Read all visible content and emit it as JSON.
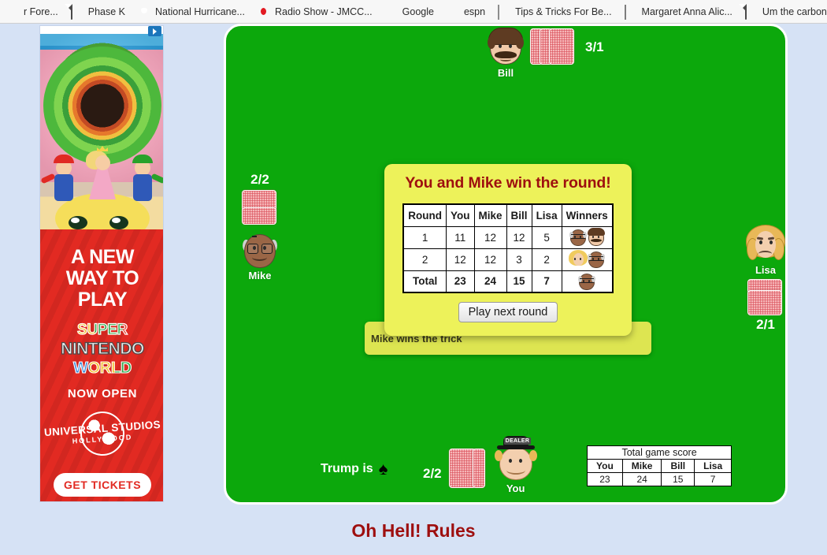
{
  "browser": {
    "bookmarks": [
      {
        "label": "r Fore...",
        "icon": "none"
      },
      {
        "label": "Phase K",
        "icon": "document-icon"
      },
      {
        "label": "National Hurricane...",
        "icon": "noaa-shield-icon"
      },
      {
        "label": "Radio Show - JMCC...",
        "icon": "radio-target-icon"
      },
      {
        "label": "Google",
        "icon": "google-g-icon"
      },
      {
        "label": "espn",
        "icon": "espn-icon"
      },
      {
        "label": "Tips & Tricks For Be...",
        "icon": "photo-thumbnail-icon"
      },
      {
        "label": "Margaret Anna Alic...",
        "icon": "photo-thumbnail-icon"
      },
      {
        "label": "Um the carbon tax i...",
        "icon": "document-icon"
      },
      {
        "label": "",
        "icon": "orange-bars-icon"
      }
    ]
  },
  "ad": {
    "headline_line1": "A NEW",
    "headline_line2": "WAY TO",
    "headline_line3": "PLAY",
    "brand_line1": "SUPER",
    "brand_line2": "NINTENDO",
    "brand_line3": "WORLD",
    "status": "NOW OPEN",
    "studio": "UNIVERSAL STUDIOS",
    "studio_sub": "HOLLYWOOD",
    "cta": "GET TICKETS"
  },
  "game": {
    "trump_label": "Trump is",
    "trump_suit": "♠",
    "players": {
      "bill": {
        "name": "Bill",
        "bid_tricks": "3/1",
        "cards": 3
      },
      "mike": {
        "name": "Mike",
        "bid_tricks": "2/2",
        "cards": 2
      },
      "lisa": {
        "name": "Lisa",
        "bid_tricks": "2/1",
        "cards": 2
      },
      "you": {
        "name": "You",
        "bid_tricks": "2/2",
        "cards": 2,
        "dealer_badge": "DEALER"
      }
    },
    "trick_message": "Mike wins the trick",
    "dialog": {
      "title": "You and Mike win the round!",
      "button": "Play next round",
      "table": {
        "headers": [
          "Round",
          "You",
          "Mike",
          "Bill",
          "Lisa",
          "Winners"
        ],
        "rows": [
          {
            "round": "1",
            "you": "11",
            "mike": "12",
            "bill": "12",
            "lisa": "5",
            "winners": [
              "mike",
              "bill"
            ]
          },
          {
            "round": "2",
            "you": "12",
            "mike": "12",
            "bill": "3",
            "lisa": "2",
            "winners": [
              "lisa",
              "mike"
            ]
          },
          {
            "round": "Total",
            "you": "23",
            "mike": "24",
            "bill": "15",
            "lisa": "7",
            "winners": [
              "mike"
            ]
          }
        ]
      }
    },
    "total_score": {
      "title": "Total game score",
      "headers": [
        "You",
        "Mike",
        "Bill",
        "Lisa"
      ],
      "values": [
        "23",
        "24",
        "15",
        "7"
      ]
    }
  },
  "footer": {
    "rules_link": "Oh Hell! Rules"
  },
  "colors": {
    "table_green": "#0ca80c",
    "dialog_yellow": "#edf25a",
    "panel_yellow": "#dde551",
    "title_red": "#9e0f0f",
    "page_blue": "#d6e2f5",
    "ad_red": "#e22a22"
  }
}
